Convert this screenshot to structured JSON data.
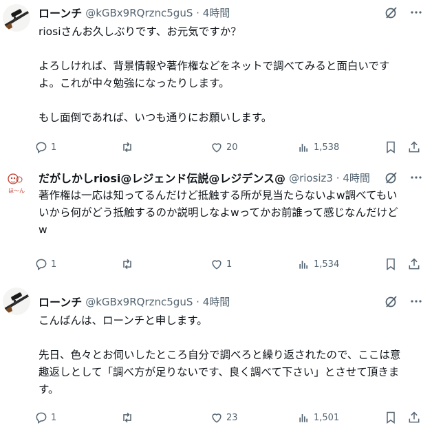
{
  "tweets": [
    {
      "name": "ローンチ",
      "handle": "@kGBx9RQrznc5guS",
      "time": "4時間",
      "text": "riosiさんお久しぶりです、お元気ですか？\n\nよろしければ、背景情報や著作権などをネットで調べてみると面白いです\nよ。これが中々勉強になったりします。\n\nもし面倒であれば、いつも通りにお願いします。",
      "replies": "1",
      "retweets": "",
      "likes": "20",
      "views": "1,538",
      "avatar": "rifle-scope-avatar"
    },
    {
      "name": "だがしかしriosi@レジェンド伝説@レジデンス@",
      "handle": "@riosiz3",
      "time": "4時間",
      "text": "著作権は一応は知ってるんだけど抵触する所が見当たらないよw調べてもい\nいから何がどう抵触するのか説明しなよwってかお前誰って感じなんだけど\nw",
      "replies": "1",
      "retweets": "",
      "likes": "1",
      "views": "1,534",
      "avatar": "sketch-character-avatar",
      "avatar_caption": "ほ〜ん"
    },
    {
      "name": "ローンチ",
      "handle": "@kGBx9RQrznc5guS",
      "time": "4時間",
      "text": "こんばんは、ローンチと申します。\n\n先日、色々とお伺いしたところ自分で調べろと繰り返されたので、ここは意\n趣返しとして「調べ方が足りないです、良く調べて下さい」とさせて頂きま\nす。",
      "replies": "1",
      "retweets": "",
      "likes": "23",
      "views": "1,501",
      "avatar": "rifle-scope-avatar"
    }
  ],
  "icons": {
    "reply": "reply-icon",
    "retweet": "retweet-icon",
    "like": "heart-icon",
    "views": "views-icon",
    "bookmark": "bookmark-icon",
    "share": "share-icon",
    "grok": "grok-icon",
    "more": "more-icon"
  },
  "separator": "·",
  "colors": {
    "text": "#0f1419",
    "secondary": "#536471",
    "background": "#ffffff"
  }
}
